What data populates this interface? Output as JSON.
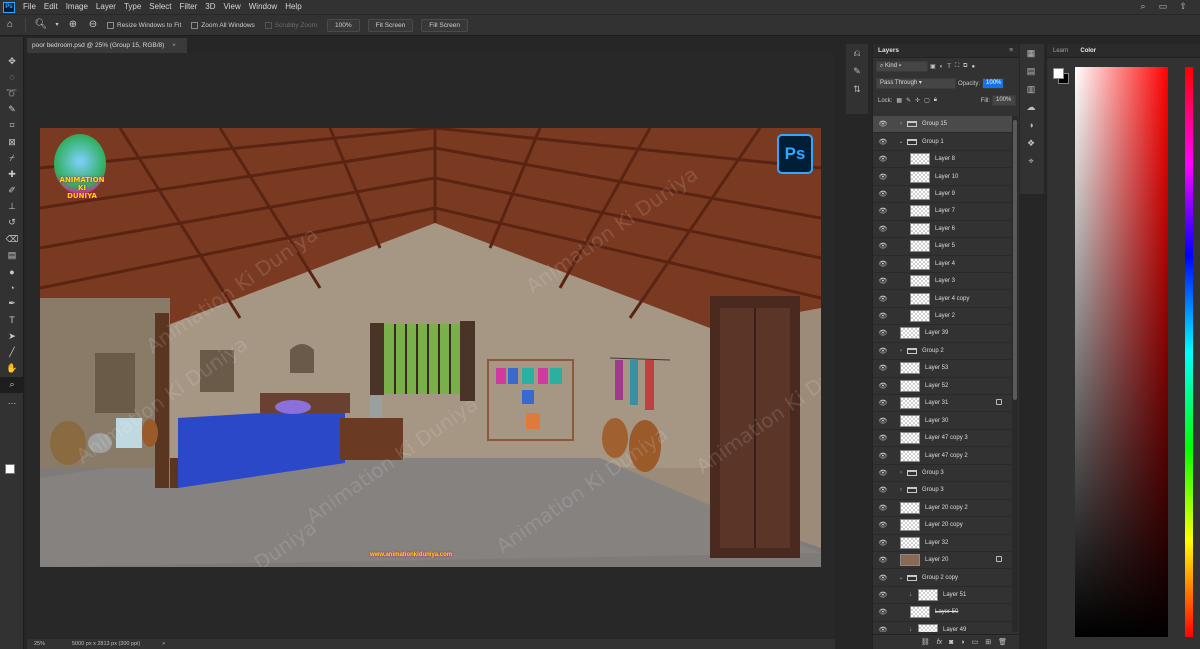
{
  "menubar": {
    "app_icon": "Ps",
    "items": [
      "File",
      "Edit",
      "Image",
      "Layer",
      "Type",
      "Select",
      "Filter",
      "3D",
      "View",
      "Window",
      "Help"
    ]
  },
  "options": {
    "resize_windows": "Resize Windows to Fit",
    "zoom_all": "Zoom All Windows",
    "scrubby_zoom": "Scrubby Zoom",
    "zoom_value": "100%",
    "fit_screen": "Fit Screen",
    "fill_screen": "Fill Screen"
  },
  "toolbar": {
    "tools": [
      "move-icon",
      "marquee-icon",
      "lasso-icon",
      "quick-select-icon",
      "crop-icon",
      "frame-icon",
      "eyedropper-icon",
      "healing-icon",
      "brush-icon",
      "stamp-icon",
      "history-brush-icon",
      "eraser-icon",
      "gradient-icon",
      "blur-icon",
      "dodge-icon",
      "pen-icon",
      "type-icon",
      "path-select-icon",
      "line-icon",
      "hand-icon",
      "zoom-icon",
      "more-icon"
    ]
  },
  "document": {
    "tab_title": "poor bedroom.psd @ 25% (Group 15, RGB/8)",
    "tab_close": "×",
    "logo_text_1": "ANIMATION",
    "logo_text_2": "KI",
    "logo_text_3": "DUNIYA",
    "ps_badge": "Ps",
    "watermark": "Animation Ki Duniya",
    "watermark_short": "Duniya",
    "url": "www.animationkiduniya.com"
  },
  "status": {
    "zoom": "25%",
    "doc_info": "5000 px x 2813 px (300 ppi)",
    "arrow": ">"
  },
  "layers_panel": {
    "title": "Layers",
    "filter_kind": "Kind",
    "blend_mode": "Pass Through",
    "opacity_label": "Opacity:",
    "opacity_value": "100%",
    "lock_label": "Lock:",
    "fill_label": "Fill:",
    "fill_value": "100%",
    "layers": [
      {
        "name": "Group 15",
        "type": "group",
        "level": 0,
        "expanded": false,
        "selected": true
      },
      {
        "name": "Group 1",
        "type": "group",
        "level": 0,
        "expanded": true
      },
      {
        "name": "Layer 8",
        "type": "layer",
        "level": 1
      },
      {
        "name": "Layer 10",
        "type": "layer",
        "level": 1
      },
      {
        "name": "Layer 9",
        "type": "layer",
        "level": 1
      },
      {
        "name": "Layer 7",
        "type": "layer",
        "level": 1
      },
      {
        "name": "Layer 6",
        "type": "layer",
        "level": 1
      },
      {
        "name": "Layer 5",
        "type": "layer",
        "level": 1
      },
      {
        "name": "Layer 4",
        "type": "layer",
        "level": 1
      },
      {
        "name": "Layer 3",
        "type": "layer",
        "level": 1
      },
      {
        "name": "Layer 4 copy",
        "type": "layer",
        "level": 1
      },
      {
        "name": "Layer 2",
        "type": "layer",
        "level": 1
      },
      {
        "name": "Layer 39",
        "type": "layer",
        "level": 0
      },
      {
        "name": "Group 2",
        "type": "group",
        "level": 0,
        "expanded": false
      },
      {
        "name": "Layer 53",
        "type": "layer",
        "level": 0
      },
      {
        "name": "Layer 52",
        "type": "layer",
        "level": 0
      },
      {
        "name": "Layer 31",
        "type": "layer",
        "level": 0,
        "locked": true
      },
      {
        "name": "Layer 30",
        "type": "layer",
        "level": 0
      },
      {
        "name": "Layer 47 copy 3",
        "type": "layer",
        "level": 0
      },
      {
        "name": "Layer 47 copy 2",
        "type": "layer",
        "level": 0
      },
      {
        "name": "Group 3",
        "type": "group",
        "level": 0,
        "expanded": false
      },
      {
        "name": "Group 3",
        "type": "group",
        "level": 0,
        "expanded": false
      },
      {
        "name": "Layer 20 copy 2",
        "type": "layer",
        "level": 0
      },
      {
        "name": "Layer 20 copy",
        "type": "layer",
        "level": 0
      },
      {
        "name": "Layer 32",
        "type": "layer",
        "level": 0
      },
      {
        "name": "Layer 20",
        "type": "layer",
        "level": 0,
        "locked": true,
        "photo": true
      },
      {
        "name": "Group 2 copy",
        "type": "group",
        "level": 0,
        "expanded": true
      },
      {
        "name": "Layer 51",
        "type": "layer",
        "level": 1,
        "clipped": true
      },
      {
        "name": "Layer 50",
        "type": "layer",
        "level": 1,
        "strike": true
      },
      {
        "name": "Layer 49",
        "type": "layer",
        "level": 1,
        "clipped": true
      }
    ]
  },
  "color_panel": {
    "tab_learn": "Learn",
    "tab_color": "Color",
    "fg_color": "#ffffff",
    "bg_color": "#000000",
    "hue": "#ff0000"
  }
}
